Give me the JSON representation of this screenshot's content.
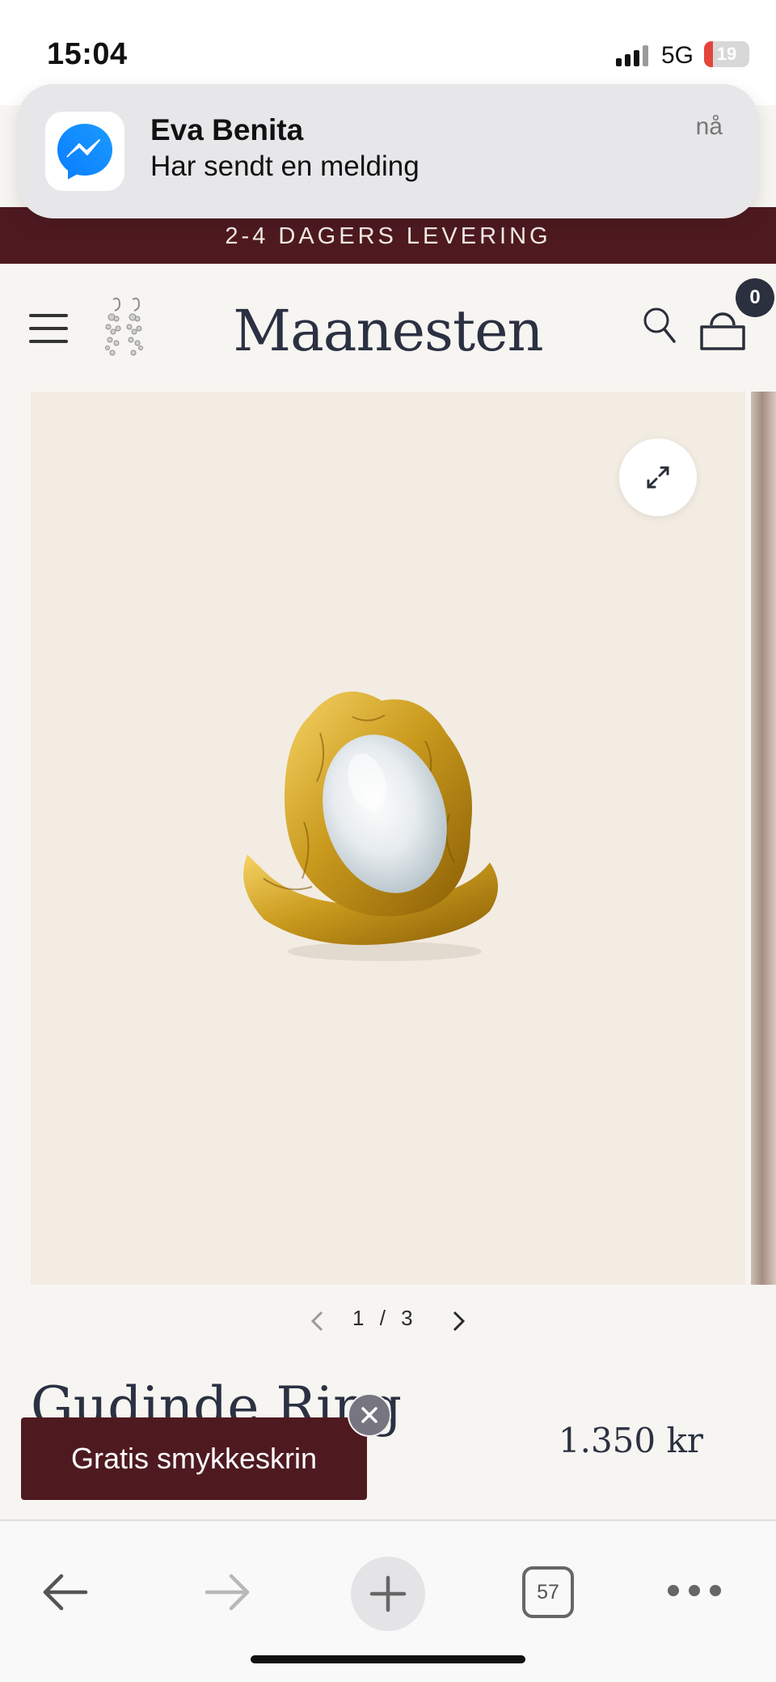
{
  "status_bar": {
    "time": "15:04",
    "network": "5G",
    "battery": "19",
    "battery_level_percent": 19,
    "battery_color": "#e5443b"
  },
  "notification": {
    "app_icon": "messenger-icon",
    "title": "Eva Benita",
    "body": "Har sendt en melding",
    "time": "nå"
  },
  "shipping_banner": {
    "text": "2-4 DAGERS LEVERING"
  },
  "header": {
    "logo_text": "Maanesten",
    "menu_icon": "hamburger-menu-icon",
    "logo_image_icon": "earring-icon",
    "search_icon": "search-icon",
    "cart_icon": "bag-icon",
    "cart_count": "0"
  },
  "gallery": {
    "expand_icon": "expand-icon",
    "current": "1",
    "separator": "/",
    "total": "3",
    "prev_icon": "chevron-left-icon",
    "next_icon": "chevron-right-icon"
  },
  "product": {
    "name": "Gudinde Ring",
    "price": "1.350 kr"
  },
  "promo": {
    "text": "Gratis smykkeskrin",
    "close_icon": "close-icon"
  },
  "browser_toolbar": {
    "back_icon": "arrow-left-icon",
    "forward_icon": "arrow-right-icon",
    "new_tab_icon": "plus-icon",
    "tab_count": "57",
    "more_icon": "more-icon"
  },
  "colors": {
    "brand_burgundy": "#4e1a20",
    "logo_navy": "#2b3142",
    "page_background": "#f7f5f1",
    "gallery_background": "#f2ece3"
  }
}
